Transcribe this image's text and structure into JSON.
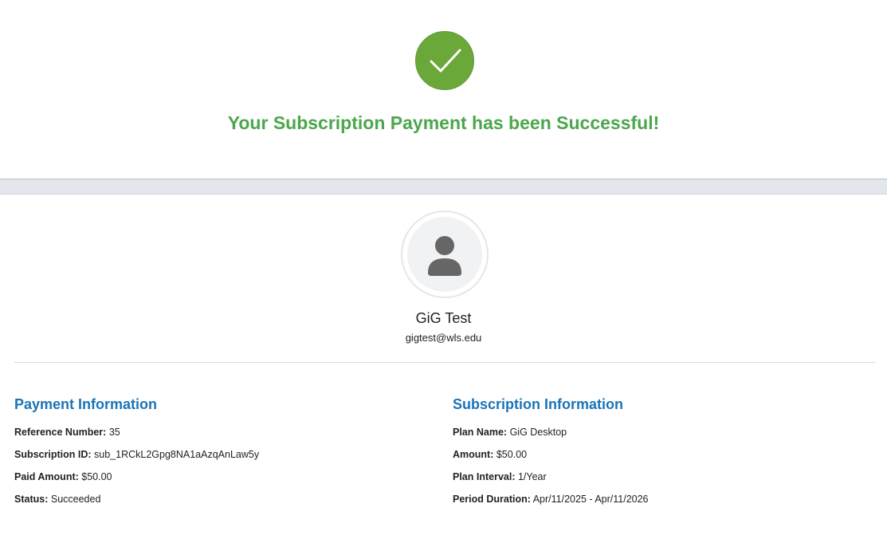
{
  "success": {
    "title": "Your Subscription Payment has been Successful!",
    "icon": "check-icon",
    "color": "#4ca64c",
    "icon_bg": "#6aa83a"
  },
  "user": {
    "name": "GiG Test",
    "email": "gigtest@wls.edu",
    "avatar_icon": "user-icon"
  },
  "payment": {
    "heading": "Payment Information",
    "rows": [
      {
        "label": "Reference Number:",
        "value": "35"
      },
      {
        "label": "Subscription ID:",
        "value": "sub_1RCkL2Gpg8NA1aAzqAnLaw5y"
      },
      {
        "label": "Paid Amount:",
        "value": "$50.00"
      },
      {
        "label": "Status:",
        "value": "Succeeded"
      }
    ]
  },
  "subscription": {
    "heading": "Subscription Information",
    "rows": [
      {
        "label": "Plan Name:",
        "value": "GiG Desktop"
      },
      {
        "label": "Amount:",
        "value": "$50.00"
      },
      {
        "label": "Plan Interval:",
        "value": "1/Year"
      },
      {
        "label": "Period Duration:",
        "value": "Apr/11/2025 - Apr/11/2026"
      }
    ]
  },
  "colors": {
    "heading_blue": "#1a74b8"
  }
}
